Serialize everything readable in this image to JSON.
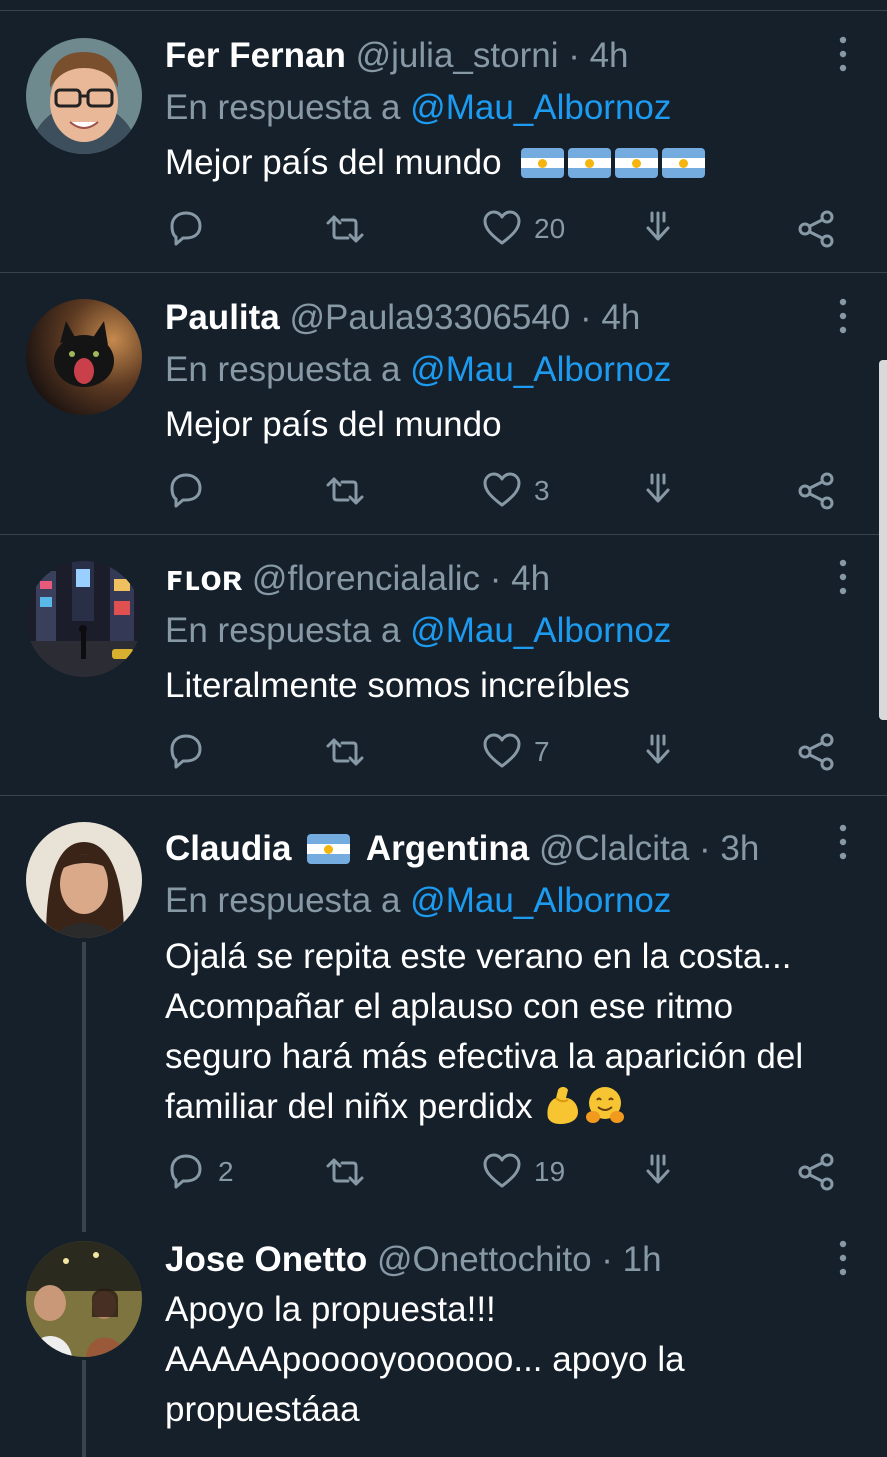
{
  "tweets": [
    {
      "name": "Fer Fernan",
      "handle": "@julia_storni",
      "dot": "·",
      "time": "4h",
      "reply_prefix": "En respuesta a",
      "reply_to": "@Mau_Albornoz",
      "text": "Mejor país del mundo",
      "flags": 4,
      "reply_count": "",
      "like_count": "20"
    },
    {
      "name": "Paulita",
      "handle": "@Paula93306540",
      "dot": "·",
      "time": "4h",
      "reply_prefix": "En respuesta a",
      "reply_to": "@Mau_Albornoz",
      "text": "Mejor país del mundo",
      "reply_count": "",
      "like_count": "3"
    },
    {
      "name": "ꜰʟᴏʀ",
      "handle": "@florencialalic",
      "dot": "·",
      "time": "4h",
      "reply_prefix": "En respuesta a",
      "reply_to": "@Mau_Albornoz",
      "text": "Literalmente somos increíbles",
      "reply_count": "",
      "like_count": "7"
    },
    {
      "name_part1": "Claudia",
      "name_part2": "Argentina",
      "handle": "@Clalcita",
      "dot": "·",
      "time": "3h",
      "reply_prefix": "En respuesta a",
      "reply_to": "@Mau_Albornoz",
      "text_lines": [
        "Ojalá se repita este verano en la costa...",
        "Acompañar el aplauso con ese ritmo",
        "seguro hará más efectiva la aparición del",
        "familiar del niñx perdidx"
      ],
      "emojis": [
        "flexed-biceps-emoji",
        "hugging-face-emoji"
      ],
      "reply_count": "2",
      "like_count": "19"
    },
    {
      "name": "Jose Onetto",
      "handle": "@Onettochito",
      "dot": "·",
      "time": "1h",
      "text_lines": [
        "Apoyo la propuesta!!!",
        "AAAAApooooyoooooo... apoyo la",
        "propuestáaa"
      ]
    }
  ],
  "icons": {
    "reply": "reply-icon",
    "retweet": "retweet-icon",
    "like": "heart-icon",
    "share": "share-arrow-icon",
    "more": "more-vertical-icon",
    "tweet_menu": "share-nodes-icon"
  },
  "colors": {
    "background": "#15202b",
    "text": "#ffffff",
    "muted": "#8899a6",
    "link": "#1d9bf0",
    "divider": "#38444d"
  }
}
